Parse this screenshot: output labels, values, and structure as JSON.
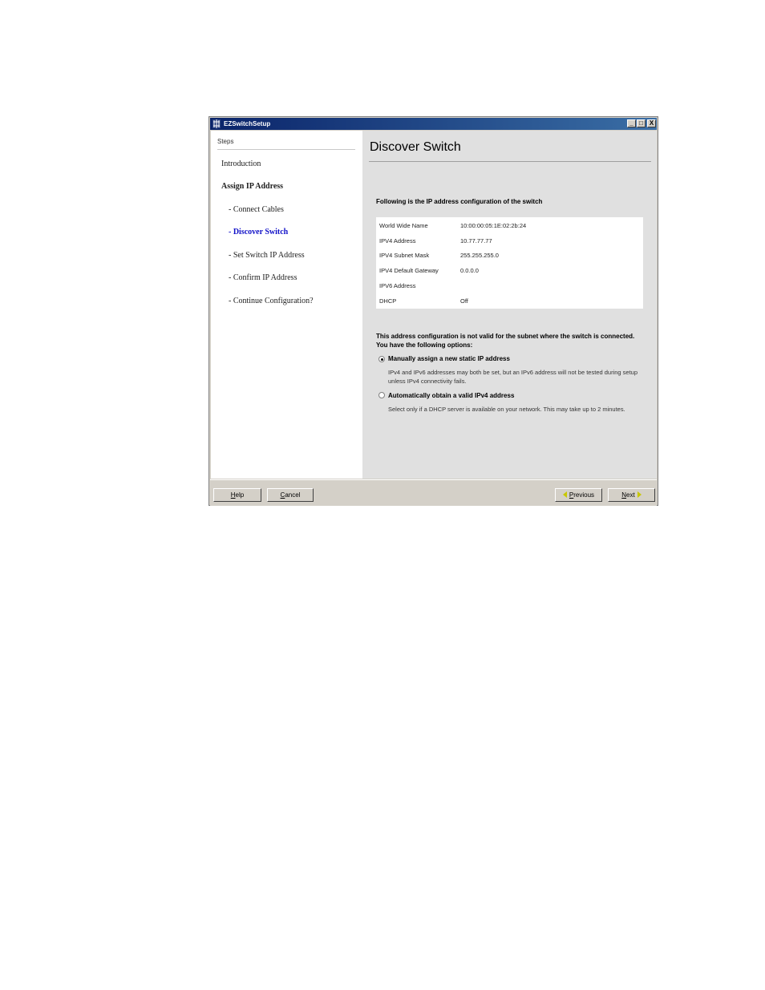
{
  "window": {
    "title": "EZSwitchSetup",
    "controls": {
      "minimize": "_",
      "maximize": "□",
      "close": "X"
    }
  },
  "steps": {
    "header": "Steps",
    "items": [
      {
        "label": "Introduction",
        "state": "normal"
      },
      {
        "label": "Assign IP Address",
        "state": "section"
      },
      {
        "label": "- Connect Cables",
        "state": "normal"
      },
      {
        "label": "- Discover Switch",
        "state": "active"
      },
      {
        "label": "- Set Switch IP Address",
        "state": "normal"
      },
      {
        "label": "- Confirm IP Address",
        "state": "normal"
      },
      {
        "label": "- Continue Configuration?",
        "state": "normal"
      }
    ]
  },
  "main": {
    "title": "Discover Switch",
    "intro": "Following is the IP address configuration of the switch",
    "config": [
      {
        "label": "World Wide Name",
        "value": "10:00:00:05:1E:02:2b:24"
      },
      {
        "label": "IPV4 Address",
        "value": "10.77.77.77"
      },
      {
        "label": "IPV4 Subnet Mask",
        "value": "255.255.255.0"
      },
      {
        "label": "IPV4 Default Gateway",
        "value": "0.0.0.0"
      },
      {
        "label": "IPV6 Address",
        "value": ""
      },
      {
        "label": "DHCP",
        "value": "Off"
      }
    ],
    "warning": "This address configuration is not valid for the subnet where the switch is connected. You have the following options:",
    "options": [
      {
        "label": "Manually assign a new static IP address",
        "description": "IPv4 and IPv6 addresses may both be set, but an IPv6 address will not be tested during setup unless IPv4 connectivity fails.",
        "selected": true
      },
      {
        "label": "Automatically obtain a valid IPv4 address",
        "description": "Select only if a DHCP server is available on your network. This may take up to 2 minutes.",
        "selected": false
      }
    ]
  },
  "buttons": {
    "help": {
      "underline": "H",
      "rest": "elp"
    },
    "cancel": {
      "underline": "C",
      "rest": "ancel"
    },
    "previous": {
      "underline": "P",
      "rest": "revious"
    },
    "next": {
      "underline": "N",
      "rest": "ext"
    }
  }
}
